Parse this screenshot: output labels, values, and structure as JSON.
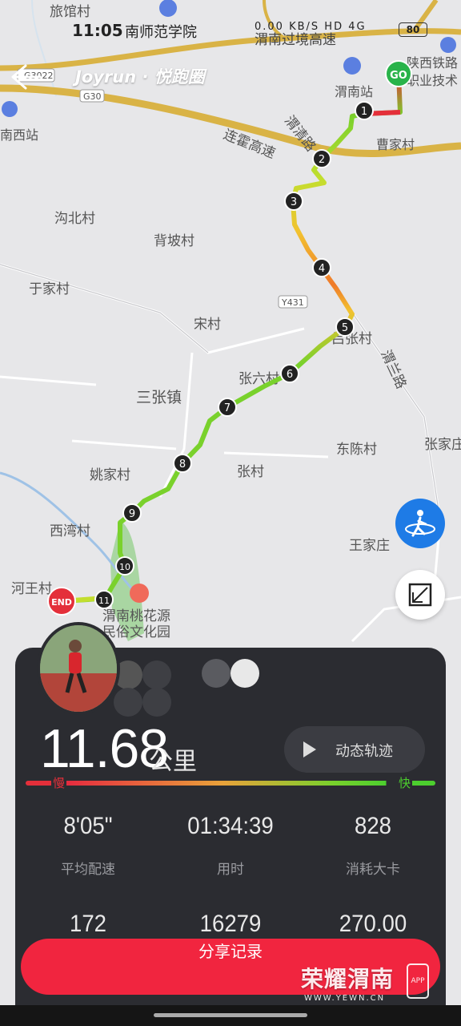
{
  "status_bar": {
    "time": "11:05",
    "notification": "南师范学院",
    "net_speed": "0.00 KB/S",
    "icons": "HD 4G",
    "battery": "80"
  },
  "header": {
    "brand": "Joyrun · 悦跑圈"
  },
  "map": {
    "labels": [
      "旅馆村",
      "渭南过境高速",
      "陕西铁路",
      "职业技术",
      "渭南站",
      "曹家村",
      "南西站",
      "渭清路",
      "连霍高速",
      "沟北村",
      "背坡村",
      "于家村",
      "宋村",
      "张六村",
      "三张镇",
      "东陈村",
      "张家庄",
      "张村",
      "姚家村",
      "西湾村",
      "王家庄",
      "河王村",
      "渭南桃花源",
      "民俗文化园",
      "渭兰路",
      "Y431",
      "G30",
      "G3022",
      "吕张村"
    ],
    "markers": [
      "1",
      "2",
      "3",
      "4",
      "5",
      "6",
      "7",
      "8",
      "9",
      "10",
      "11"
    ],
    "start_label": "GO",
    "end_label": "END",
    "colors": {
      "slow": "#e42f3a",
      "mid": "#f2c230",
      "fast": "#4ccf2e",
      "road": "#d9b346"
    }
  },
  "summary": {
    "distance": "11.68",
    "distance_unit": "公里",
    "track_button": "动态轨迹",
    "pace_slow_label": "慢",
    "pace_fast_label": "快",
    "stats": [
      {
        "value": "8'05\"",
        "label": "平均配速"
      },
      {
        "value": "01:34:39",
        "label": "用时"
      },
      {
        "value": "828",
        "label": "消耗大卡"
      },
      {
        "value": "172",
        "label": ""
      },
      {
        "value": "16279",
        "label": ""
      },
      {
        "value": "270.00",
        "label": ""
      }
    ]
  },
  "share_button": "分享记录",
  "watermark": {
    "title": "荣耀渭南",
    "url": "WWW.YEWN.CN",
    "app": "APP"
  }
}
